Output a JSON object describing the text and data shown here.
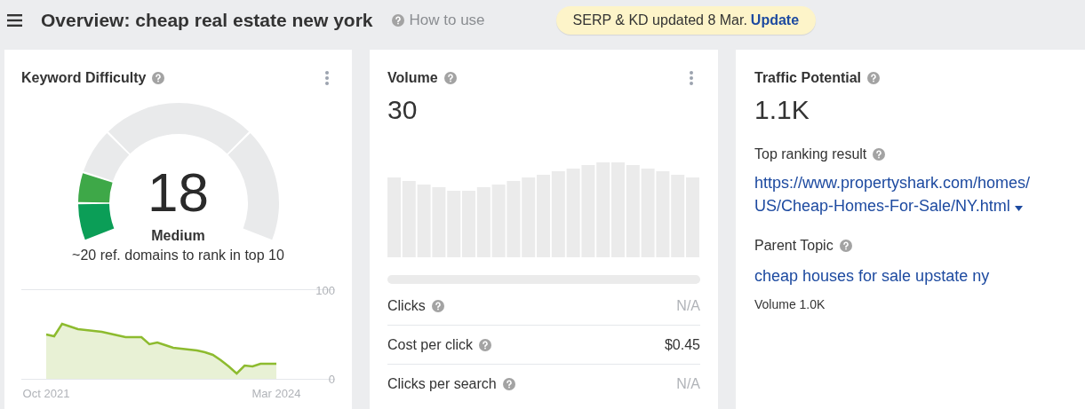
{
  "header": {
    "title": "Overview: cheap real estate new york",
    "help_link": "How to use",
    "notice": {
      "text": "SERP & KD updated 8 Mar.",
      "action": "Update"
    }
  },
  "keyword_difficulty": {
    "title": "Keyword Difficulty",
    "score": "18",
    "rating": "Medium",
    "note": "~20 ref. domains to rank in top 10",
    "chart_data": {
      "type": "area",
      "categories": [
        "Oct 2021",
        null,
        null,
        null,
        null,
        null,
        null,
        null,
        null,
        null,
        null,
        null,
        null,
        null,
        null,
        null,
        null,
        null,
        null,
        null,
        null,
        null,
        null,
        null,
        null,
        null,
        null,
        null,
        null,
        "Mar 2024"
      ],
      "series": [
        {
          "color": "#8dbb2f",
          "values": [
            50,
            48,
            62,
            59,
            56,
            55,
            54,
            53,
            51,
            49,
            47,
            47,
            47,
            39,
            41,
            38,
            35,
            34,
            33,
            32,
            30,
            27,
            21,
            14,
            6,
            15,
            14,
            17,
            17,
            17
          ]
        }
      ],
      "ylim": [
        0,
        100
      ],
      "yticks": [
        100,
        0
      ]
    }
  },
  "volume": {
    "title": "Volume",
    "value": "30",
    "metrics": [
      {
        "label": "Clicks",
        "value": "N/A",
        "muted": true
      },
      {
        "label": "Cost per click",
        "value": "$0.45",
        "muted": false
      },
      {
        "label": "Clicks per search",
        "value": "N/A",
        "muted": true
      }
    ]
  },
  "traffic_potential": {
    "title": "Traffic Potential",
    "value": "1.1K",
    "top_result_label": "Top ranking result",
    "top_result_url_lines": [
      "https://www.propertyshark.com/homes/",
      "US/Cheap-Homes-For-Sale/NY.html"
    ],
    "parent_topic_label": "Parent Topic",
    "parent_topic": "cheap houses for sale upstate ny",
    "parent_volume": "Volume 1.0K"
  }
}
